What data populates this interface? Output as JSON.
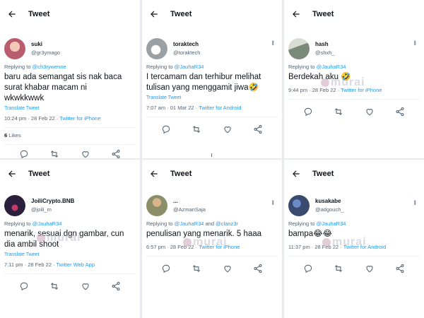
{
  "header_title": "Tweet",
  "watermark": "murai",
  "panels": [
    {
      "name": "suki",
      "handle": "@gr3ymago",
      "replying_prefix": "Replying to ",
      "replying_to": "@ch3rywenne",
      "text": "baru ada semangat sis nak baca\nsurat khabar macam ni\nwkwkkwwk",
      "translate": "Translate Tweet",
      "time": "10:24 pm · 28 Feb 22 · ",
      "source": "Twitter for iPhone",
      "likes_count": "6",
      "likes_label": " Likes",
      "avatar_color": "#b85c6e"
    },
    {
      "name": "toraktech",
      "handle": "@toraktech",
      "replying_prefix": "Replying to ",
      "replying_to": "@JauhaR34",
      "text": "I tercamam dan terhibur melihat\ntulisan yang menggamit jiwa🤣",
      "translate": "Translate Tweet",
      "time": "7:07 am · 01 Mar 22 · ",
      "source": "Twitter for Android",
      "avatar_color": "#9aa0a4"
    },
    {
      "name": "hash",
      "handle": "@shxh_",
      "replying_prefix": "Replying to ",
      "replying_to": "@JauhaR34",
      "text": "Berdekah aku 🤣",
      "time": "9:44 pm · 28 Feb 22 · ",
      "source": "Twitter for iPhone",
      "avatar_color": "#7a8a78"
    },
    {
      "name": "JoiliCrypto.BNB",
      "handle": "@joili_m",
      "replying_prefix": "Replying to ",
      "replying_to": "@JauhaR34",
      "text": "menarik, sesuai dgn gambar, cun\ndia ambil shoot",
      "translate": "Translate Tweet",
      "time": "7:11 pm · 28 Feb 22 · ",
      "source": "Twitter Web App",
      "avatar_color": "#2a1f3d"
    },
    {
      "name": "...",
      "handle": "@AzmanSaja",
      "replying_prefix": "Replying to ",
      "replying_to": "@JauhaR34",
      "replying_and": " and ",
      "replying_to2": "@clanz3r",
      "text": "penulisan yang menarik. 5 haaa",
      "time": "6:57 pm · 28 Feb 22 · ",
      "source": "Twitter for iPhone",
      "avatar_color": "#8a8f6a"
    },
    {
      "name": "kusakabe",
      "handle": "@adgouch_",
      "replying_prefix": "Replying to ",
      "replying_to": "@JauhaR34",
      "text": "bampa😂😂",
      "time": "11:37 pm · 28 Feb 22 · ",
      "source": "Twitter for Android",
      "avatar_color": "#3a4a6e"
    }
  ],
  "icons": {
    "back": "arrow-left-icon",
    "reply": "reply-icon",
    "retweet": "retweet-icon",
    "like": "heart-icon",
    "share": "share-icon",
    "more": "more-icon"
  },
  "colors": {
    "link": "#1d9bf0",
    "muted": "#536471",
    "text": "#0f1419"
  }
}
